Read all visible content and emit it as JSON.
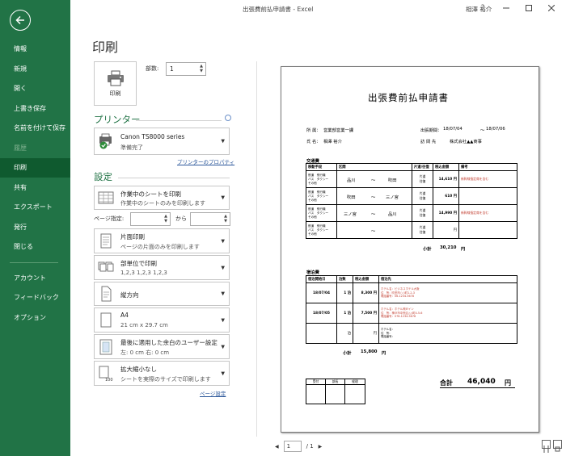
{
  "window": {
    "title": "出張費前払申請書 - Excel",
    "user": "相澤 裕介",
    "help": "?"
  },
  "sidebar": {
    "items": [
      {
        "label": "情報",
        "state": "normal"
      },
      {
        "label": "新規",
        "state": "normal"
      },
      {
        "label": "開く",
        "state": "normal"
      },
      {
        "label": "上書き保存",
        "state": "normal"
      },
      {
        "label": "名前を付けて保存",
        "state": "normal"
      },
      {
        "label": "履歴",
        "state": "disabled"
      },
      {
        "label": "印刷",
        "state": "active"
      },
      {
        "label": "共有",
        "state": "normal"
      },
      {
        "label": "エクスポート",
        "state": "normal"
      },
      {
        "label": "発行",
        "state": "normal"
      },
      {
        "label": "閉じる",
        "state": "normal"
      },
      {
        "label": "アカウント",
        "state": "normal"
      },
      {
        "label": "フィードバック",
        "state": "normal"
      },
      {
        "label": "オプション",
        "state": "normal"
      }
    ]
  },
  "print": {
    "heading": "印刷",
    "button_label": "印刷",
    "copies_label": "部数:",
    "copies_value": "1"
  },
  "printer": {
    "heading": "プリンター",
    "name": "Canon TS8000 series",
    "status": "準備完了",
    "properties_link": "プリンターのプロパティ"
  },
  "settings": {
    "heading": "設定",
    "what": {
      "l1": "作業中のシートを印刷",
      "l2": "作業中のシートのみを印刷します"
    },
    "pages_label": "ページ指定:",
    "pages_to": "から",
    "sides": {
      "l1": "片面印刷",
      "l2": "ページの片面のみを印刷します"
    },
    "collate": {
      "l1": "部単位で印刷",
      "l2": "1,2,3   1,2,3   1,2,3"
    },
    "orientation": {
      "l1": "縦方向"
    },
    "paper": {
      "l1": "A4",
      "l2": "21 cm x 29.7 cm"
    },
    "margins": {
      "l1": "最後に適用した余白のユーザー設定",
      "l2": "左: 0 cm    右: 0 cm"
    },
    "scaling": {
      "l1": "拡大縮小なし",
      "l2": "シートを実際のサイズで印刷します"
    },
    "page_setup_link": "ページ設定"
  },
  "pager": {
    "current": "1",
    "total": "/ 1"
  },
  "document": {
    "title": "出張費前払申請書",
    "dept_label": "所 属：",
    "dept_value": "営業部営業一課",
    "name_label": "氏 名：",
    "name_value": "相澤 裕介",
    "period_label": "出張期間：",
    "period_from": "18/07/04",
    "period_tilde": "～",
    "period_to": "18/07/06",
    "dest_label": "訪 問 先",
    "dest_value": "株式会社▲▲商事",
    "transport_heading": "交通費",
    "t_headers": [
      "移動手段",
      "区間",
      "片道/往復",
      "税込金額",
      "備考"
    ],
    "t_mode": "鉄道　飛行機\nバス　タクシー\nその他",
    "t_rows": [
      {
        "from": "品川",
        "tilde": "～",
        "to": "吹田",
        "trip": "片道\n往復",
        "amount": "14,610",
        "unit": "円",
        "note": "新幹線指定席を含む"
      },
      {
        "from": "吹田",
        "tilde": "～",
        "to": "三ノ宮",
        "trip": "片道\n往復",
        "amount": "610",
        "unit": "円",
        "note": ""
      },
      {
        "from": "三ノ宮",
        "tilde": "～",
        "to": "品川",
        "trip": "片道\n往復",
        "amount": "14,990",
        "unit": "円",
        "note": "新幹線指定席を含む"
      },
      {
        "from": "",
        "tilde": "～",
        "to": "",
        "trip": "片道\n往復",
        "amount": "",
        "unit": "円",
        "note": ""
      }
    ],
    "t_subtotal_label": "小計",
    "t_subtotal_value": "30,210",
    "t_subtotal_unit": "円",
    "lodging_heading": "宿泊費",
    "l_headers": [
      "宿泊開始日",
      "泊数",
      "税込金額",
      "宿泊先"
    ],
    "l_rows": [
      {
        "date": "18/07/04",
        "nights": "1",
        "haku": "泊",
        "amount": "8,300",
        "unit": "円",
        "dest": "ホテル名：ビジネスホテル大阪\n住　所：吹田市○○町1-2-3\n電話番号：06-1234-5678"
      },
      {
        "date": "18/07/05",
        "nights": "1",
        "haku": "泊",
        "amount": "7,500",
        "unit": "円",
        "dest": "ホテル名：ホテル神戸イン\n住　所：神戸市中央区△△町4-5-6\n電話番号：078-1234-5678"
      },
      {
        "date": "",
        "nights": "",
        "haku": "泊",
        "amount": "",
        "unit": "円",
        "dest": "ホテル名：\n住　所：\n電話番号："
      }
    ],
    "l_subtotal_label": "小計",
    "l_subtotal_value": "15,800",
    "l_subtotal_unit": "円",
    "approval": [
      "受付",
      "部長",
      "経理"
    ],
    "total_label": "合計",
    "total_value": "46,040",
    "total_unit": "円"
  }
}
